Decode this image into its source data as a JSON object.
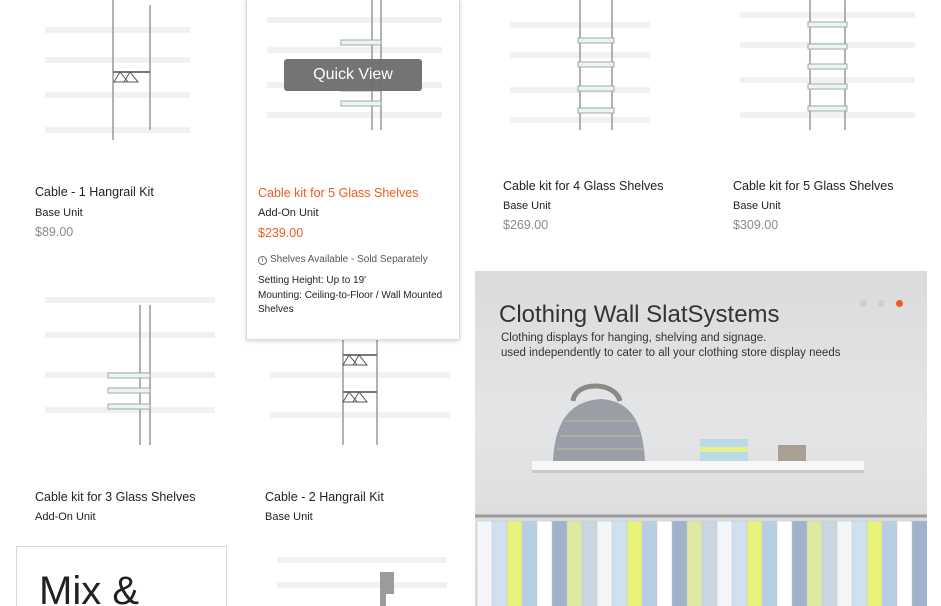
{
  "products": [
    {
      "name": "Cable - 1 Hangrail Kit",
      "unit": "Base Unit",
      "price": "$89.00"
    },
    {
      "name": "Cable kit for 5 Glass Shelves",
      "unit": "Add-On Unit",
      "price": "$239.00"
    },
    {
      "name": "Cable kit for 4 Glass Shelves",
      "unit": "Base Unit",
      "price": "$269.00"
    },
    {
      "name": "Cable kit for 5 Glass Shelves",
      "unit": "Base Unit",
      "price": "$309.00"
    },
    {
      "name": "Cable kit for 3 Glass Shelves",
      "unit": "Add-On Unit"
    },
    {
      "name": "Cable - 2 Hangrail Kit",
      "unit": "Base Unit"
    }
  ],
  "hover": {
    "quick_view": "Quick View",
    "availability": "Shelves Available - Sold Separately",
    "spec1": "Setting Height: Up to 19'",
    "spec2": "Mounting: Ceiling-to-Floor / Wall Mounted Shelves"
  },
  "banner": {
    "title": "Clothing Wall SlatSystems",
    "line1": "Clothing displays for hanging, shelving and signage.",
    "line2": "used independently to cater to all your clothing store display needs"
  },
  "mix": {
    "text": "Mix &"
  },
  "colors": {
    "accent": "#f05a1e",
    "price_gray": "#8a8a8a"
  }
}
